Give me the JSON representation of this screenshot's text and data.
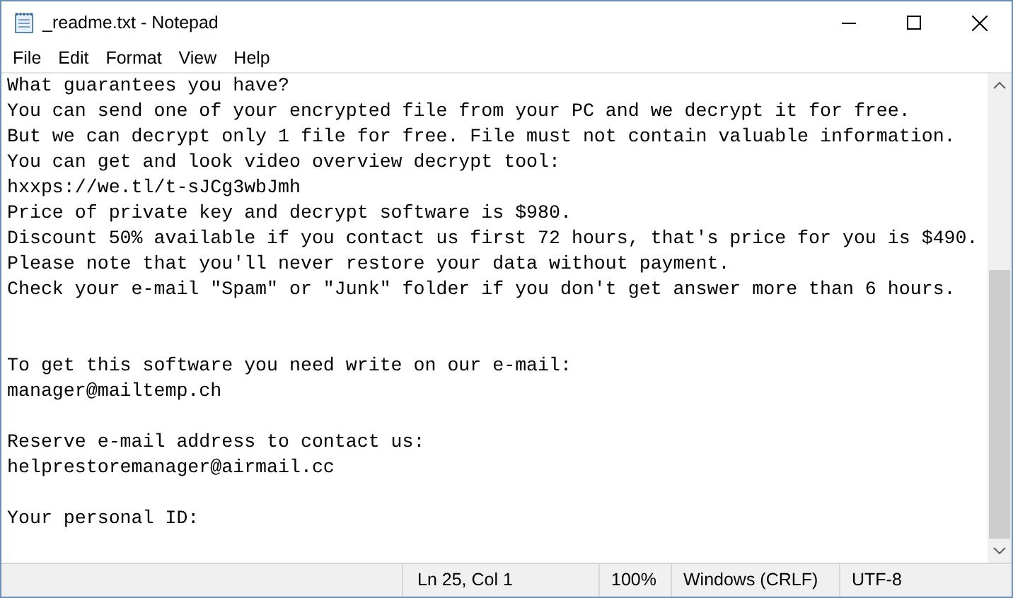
{
  "window": {
    "title": "_readme.txt - Notepad"
  },
  "menu": [
    "File",
    "Edit",
    "Format",
    "View",
    "Help"
  ],
  "editor": {
    "lines": [
      {
        "kind": "text",
        "text": "What guarantees you have?"
      },
      {
        "kind": "text",
        "text": "You can send one of your encrypted file from your PC and we decrypt it for free."
      },
      {
        "kind": "text",
        "text": "But we can decrypt only 1 file for free. File must not contain valuable information."
      },
      {
        "kind": "text",
        "text": "You can get and look video overview decrypt tool:"
      },
      {
        "kind": "text",
        "text": "hxxps://we.tl/t-sJCg3wbJmh"
      },
      {
        "kind": "text",
        "text": "Price of private key and decrypt software is $980."
      },
      {
        "kind": "text",
        "text": "Discount 50% available if you contact us first 72 hours, that's price for you is $490."
      },
      {
        "kind": "text",
        "text": "Please note that you'll never restore your data without payment."
      },
      {
        "kind": "text",
        "text": "Check your e-mail \"Spam\" or \"Junk\" folder if you don't get answer more than 6 hours."
      },
      {
        "kind": "blank"
      },
      {
        "kind": "blank"
      },
      {
        "kind": "text",
        "text": "To get this software you need write on our e-mail:"
      },
      {
        "kind": "text",
        "text": "manager@mailtemp.ch"
      },
      {
        "kind": "blank"
      },
      {
        "kind": "text",
        "text": "Reserve e-mail address to contact us:"
      },
      {
        "kind": "text",
        "text": "helprestoremanager@airmail.cc"
      },
      {
        "kind": "blank"
      },
      {
        "kind": "text",
        "text": "Your personal ID:"
      }
    ]
  },
  "status_bar": {
    "position": "Ln 25, Col 1",
    "zoom": "100%",
    "line_endings": "Windows (CRLF)",
    "encoding": "UTF-8"
  }
}
